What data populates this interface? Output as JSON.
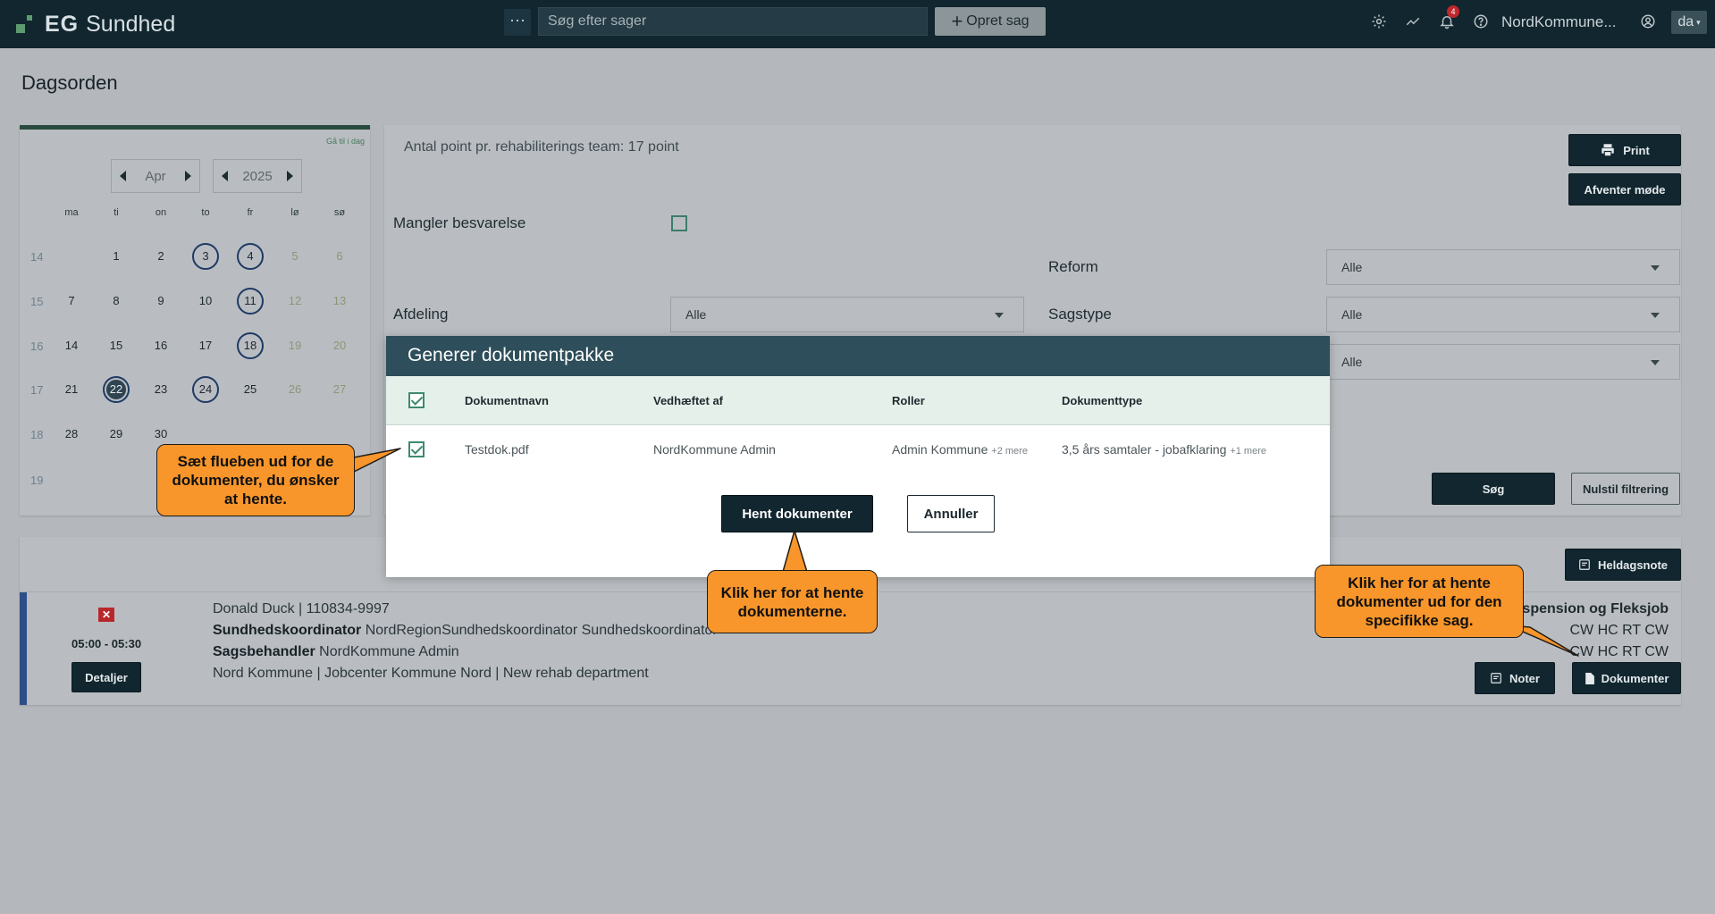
{
  "app": {
    "brand_short": "EG",
    "brand_name": "Sundhed"
  },
  "topbar": {
    "more_label": "⋯",
    "search_placeholder": "Søg efter sager",
    "create_label": "Opret sag",
    "notifications_count": "4",
    "user_name": "NordKommune...",
    "language": "da",
    "icons": [
      "gear-icon",
      "trend-icon",
      "bell-icon",
      "help-icon",
      "user-icon"
    ]
  },
  "page": {
    "title": "Dagsorden"
  },
  "calendar": {
    "goto_today": "Gå til i dag",
    "month": "Apr",
    "year": "2025",
    "weekdays": [
      "ma",
      "ti",
      "on",
      "to",
      "fr",
      "lø",
      "sø"
    ],
    "weeks": [
      {
        "no": "14",
        "days": [
          "",
          "1",
          "2",
          "3",
          "4",
          "5",
          "6"
        ]
      },
      {
        "no": "15",
        "days": [
          "7",
          "8",
          "9",
          "10",
          "11",
          "12",
          "13"
        ]
      },
      {
        "no": "16",
        "days": [
          "14",
          "15",
          "16",
          "17",
          "18",
          "19",
          "20"
        ]
      },
      {
        "no": "17",
        "days": [
          "21",
          "22",
          "23",
          "24",
          "25",
          "26",
          "27"
        ]
      },
      {
        "no": "18",
        "days": [
          "28",
          "29",
          "30",
          "",
          "",
          "",
          ""
        ]
      },
      {
        "no": "19",
        "days": [
          "",
          "",
          "",
          "",
          "",
          "",
          ""
        ]
      }
    ],
    "marked_days": [
      "3",
      "4",
      "11",
      "18",
      "22",
      "24"
    ],
    "selected_day": "22"
  },
  "filters": {
    "points_text": "Antal point pr. rehabiliterings team: 17 point",
    "print_label": "Print",
    "await_label": "Afventer møde",
    "missing_answer_label": "Mangler besvarelse",
    "reform_label": "Reform",
    "reform_value": "Alle",
    "department_label": "Afdeling",
    "department_value": "Alle",
    "case_type_label": "Sagstype",
    "case_type_value": "Alle",
    "third_value": "Alle",
    "search_label": "Søg",
    "reset_label": "Nulstil filtrering"
  },
  "results": {
    "all_day_note_label": "Heldagsnote",
    "case": {
      "time": "05:00 - 05:30",
      "details_label": "Detaljer",
      "person": "Donald Duck | 110834-9997",
      "coordinator_label": "Sundhedskoordinator",
      "coordinator_value": "NordRegionSundhedskoordinator Sundhedskoordinator",
      "caseworker_label": "Sagsbehandler",
      "caseworker_value": "NordKommune Admin",
      "location": "Nord Kommune | Jobcenter Kommune Nord | New rehab department",
      "case_type_partial": "tidspension og Fleksjob",
      "initials_1": "CW HC RT CW",
      "initials_2": "CW HC RT CW",
      "notes_label": "Noter",
      "documents_label": "Dokumenter"
    }
  },
  "modal": {
    "title": "Generer dokumentpakke",
    "columns": [
      "Dokumentnavn",
      "Vedhæftet af",
      "Roller",
      "Dokumenttype"
    ],
    "rows": [
      {
        "name": "Testdok.pdf",
        "attached_by": "NordKommune Admin",
        "roles": "Admin Kommune",
        "roles_more": "+2 mere",
        "doc_type": "3,5 års samtaler - jobafklaring",
        "doc_type_more": "+1 mere"
      }
    ],
    "fetch_label": "Hent dokumenter",
    "cancel_label": "Annuller"
  },
  "callouts": {
    "checkbox_tip": "Sæt flueben ud for de dokumenter, du ønsker at hente.",
    "fetch_tip": "Klik her for at hente dokumenterne.",
    "case_docs_tip": "Klik her for at hente dokumenter ud for den specifikke sag."
  },
  "colors": {
    "topbar": "#11262f",
    "modal_header": "#2d4e5a",
    "accent_green": "#3d8a6f",
    "callout": "#f8962b",
    "case_stripe": "#2d4e86"
  }
}
